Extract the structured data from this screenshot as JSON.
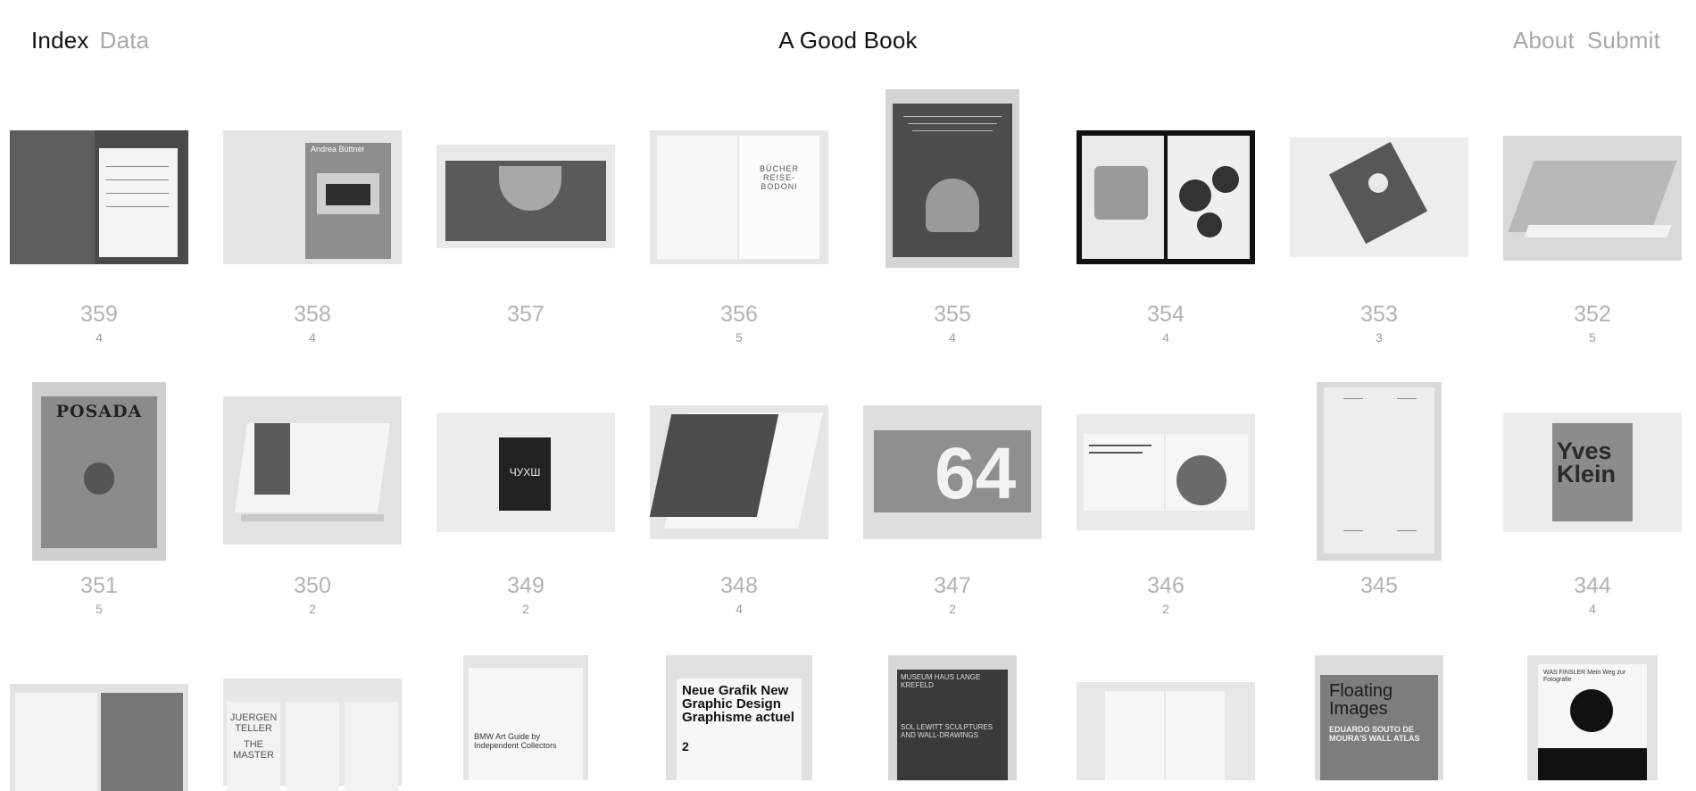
{
  "header": {
    "nav_index": "Index",
    "nav_data": "Data",
    "site_title": "A Good Book",
    "nav_about": "About",
    "nav_submit": "Submit"
  },
  "items": [
    {
      "number": "359",
      "count": "4"
    },
    {
      "number": "358",
      "count": "4"
    },
    {
      "number": "357",
      "count": ""
    },
    {
      "number": "356",
      "count": "5"
    },
    {
      "number": "355",
      "count": "4"
    },
    {
      "number": "354",
      "count": "4"
    },
    {
      "number": "353",
      "count": "3"
    },
    {
      "number": "352",
      "count": "5"
    },
    {
      "number": "351",
      "count": "5"
    },
    {
      "number": "350",
      "count": "2"
    },
    {
      "number": "349",
      "count": "2"
    },
    {
      "number": "348",
      "count": "4"
    },
    {
      "number": "347",
      "count": "2"
    },
    {
      "number": "346",
      "count": "2"
    },
    {
      "number": "345",
      "count": ""
    },
    {
      "number": "344",
      "count": "4"
    }
  ],
  "cover_texts": {
    "b358_author": "Andrea Büttner",
    "b356_title": "BÜCHER REISE-BODONI",
    "b351_title": "POSADA",
    "b349_title": "ЧУХШ",
    "b347_title": "64",
    "b344_title": "Yves Klein",
    "b0_title": "JUERGEN TELLER",
    "b0_sub": "THE MASTER",
    "b1_title": "Neue Grafik New Graphic Design Graphisme actuel",
    "b1_num": "2",
    "b2_title": "MUSEUM HAUS LANGE KREFELD",
    "b2_sub": "SOL LEWITT SCULPTURES AND WALL-DRAWINGS",
    "b3_title": "Floating Images",
    "b3_sub": "EDUARDO SOUTO DE MOURA'S WALL ATLAS",
    "b4_title": "WAS FINSLER Mein Weg zur Fotografie",
    "b5_title": "BMW Art Guide by Independent Collectors"
  }
}
